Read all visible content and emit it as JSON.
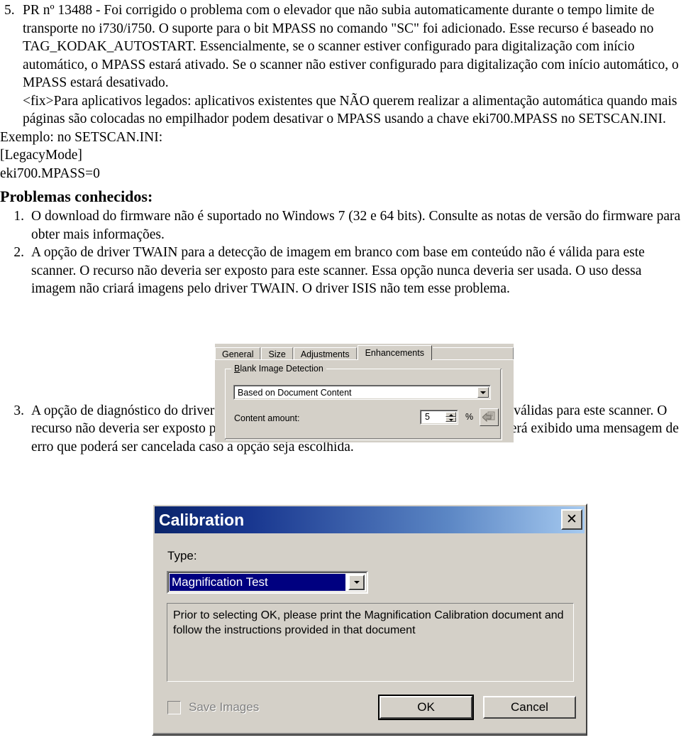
{
  "document": {
    "item5": {
      "marker": "5.",
      "text": "PR nº 13488 - Foi corrigido o problema com o elevador que não subia automaticamente durante o tempo limite de transporte no i730/i750.  O suporte para o bit MPASS no comando \"SC\" foi adicionado. Esse recurso é baseado no TAG_KODAK_AUTOSTART. Essencialmente, se o scanner estiver configurado para digitalização com início automático, o MPASS estará ativado. Se o scanner não estiver configurado para digitalização com início automático, o MPASS estará desativado.",
      "text2": "<fix>Para aplicativos legados: aplicativos existentes que NÃO querem realizar a alimentação automática quando mais páginas são colocadas no empilhador podem desativar o MPASS usando a chave eki700.MPASS no SETSCAN.INI."
    },
    "example_line": "Exemplo: no SETSCAN.INI:",
    "ini_section": "[LegacyMode]",
    "ini_key": "eki700.MPASS=0",
    "known_issues_heading": "Problemas conhecidos:",
    "known_issues": [
      {
        "marker": "1.",
        "text": "O download do firmware não é suportado no Windows 7 (32 e 64 bits). Consulte as notas de versão do firmware para obter mais informações."
      },
      {
        "marker": "2.",
        "text": "A opção de driver TWAIN para a detecção de imagem em branco com base em conteúdo não é válida para este scanner. O recurso não deveria ser exposto para este scanner. Essa opção nunca deveria ser usada.  O uso dessa imagem não criará imagens pelo driver TWAIN. O driver ISIS não tem esse problema."
      },
      {
        "marker": "3.",
        "text": "A opção de diagnóstico do driver TWAIN para teste e calibração de ampliação não são válidas para este scanner. O recurso não deveria ser exposto para este scanner. Essa opção nunca deve ser usada e será exibido uma mensagem de erro que poderá ser cancelada caso a opção seja escolhida."
      }
    ]
  },
  "figure_twain": {
    "tabs": [
      {
        "label": "General",
        "active": false
      },
      {
        "label": "Size",
        "active": false
      },
      {
        "label": "Adjustments",
        "active": false
      },
      {
        "label": "Enhancements",
        "active": true
      }
    ],
    "group_title_accel": "B",
    "group_title_rest": "lank Image Detection",
    "combo_value": "Based on Document Content",
    "content_amount_label": "Content amount:",
    "content_amount_value": "5",
    "percent_sign": "%",
    "reset_icon": "undo-arrow-icon",
    "dropdown_icon": "chevron-down-icon",
    "spin_up_icon": "spin-up-icon",
    "spin_down_icon": "spin-down-icon"
  },
  "figure_calibration": {
    "title": "Calibration",
    "close_label": "✕",
    "type_label": "Type:",
    "type_value": "Magnification Test",
    "dropdown_icon": "chevron-down-icon",
    "instructions": "Prior to selecting OK, please print the Magnification Calibration document and follow the instructions provided in that document",
    "save_images_label": "Save Images",
    "save_images_checked": false,
    "save_images_disabled": true,
    "ok_label": "OK",
    "cancel_label": "Cancel"
  },
  "colors": {
    "dialog_face": "#d4d0c8",
    "titlebar_start": "#0a246a",
    "titlebar_end": "#a6caf0",
    "selection_blue": "#000080",
    "disabled_text": "#808080"
  }
}
